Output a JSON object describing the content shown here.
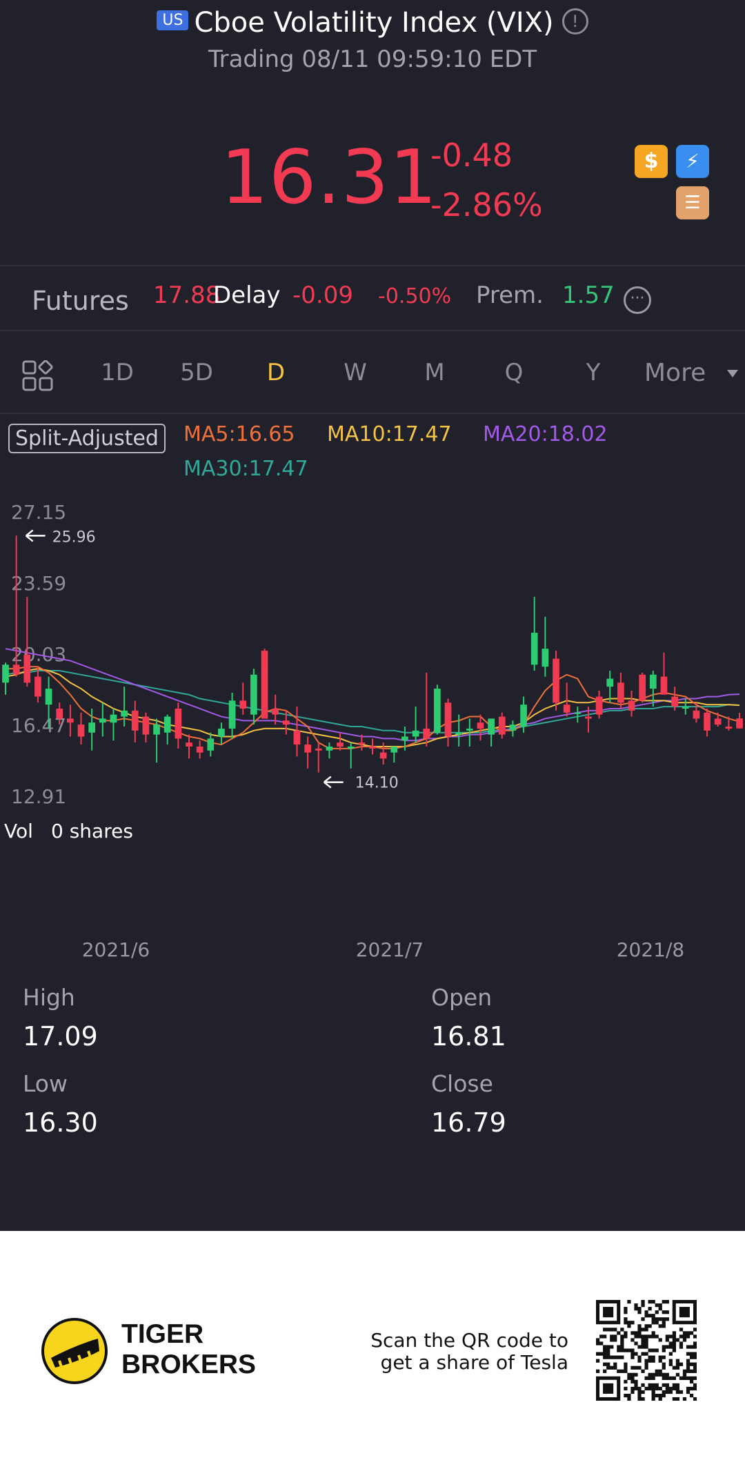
{
  "header": {
    "market_badge": "US",
    "title": "Cboe Volatility Index (VIX)",
    "info_icon": "!",
    "status": "Trading 08/11 09:59:10 EDT"
  },
  "quote": {
    "price": "16.31",
    "change": "-0.48",
    "change_pct": "-2.86%",
    "down_color": "#f23b52",
    "icons": [
      "dollar-icon",
      "lightning-icon",
      "stack-icon"
    ]
  },
  "futures": {
    "label": "Futures",
    "price": "17.88",
    "delay": "Delay",
    "change": "-0.09",
    "change_pct": "-0.50%",
    "prem_label": "Prem.",
    "prem_value": "1.57"
  },
  "tabs": {
    "items": [
      "1D",
      "5D",
      "D",
      "W",
      "M",
      "Q",
      "Y"
    ],
    "active": "D",
    "more": "More"
  },
  "chart_legend": {
    "adjust": "Split-Adjusted",
    "ma5": "MA5:16.65",
    "ma10": "MA10:17.47",
    "ma20": "MA20:18.02",
    "ma30": "MA30:17.47",
    "ma5_color": "#f0703a",
    "ma10_color": "#f6c244",
    "ma20_color": "#a35ae8",
    "ma30_color": "#31a89a"
  },
  "chart_data": {
    "type": "candlestick",
    "y_ticks": [
      "27.15",
      "23.59",
      "20.03",
      "16.47",
      "12.91"
    ],
    "ylim": [
      12.91,
      27.15
    ],
    "x_labels": [
      "2021/6",
      "2021/7",
      "2021/8"
    ],
    "max_marker": "25.96",
    "min_marker": "14.10",
    "up_color": "#2ecc71",
    "down_color": "#f23b52",
    "candles": [
      {
        "o": 18.6,
        "h": 19.6,
        "l": 18.0,
        "c": 19.5
      },
      {
        "o": 19.5,
        "h": 25.96,
        "l": 18.9,
        "c": 19.0
      },
      {
        "o": 20.0,
        "h": 22.9,
        "l": 18.4,
        "c": 18.6
      },
      {
        "o": 18.9,
        "h": 19.4,
        "l": 17.6,
        "c": 17.9
      },
      {
        "o": 17.5,
        "h": 18.9,
        "l": 16.3,
        "c": 18.3
      },
      {
        "o": 17.3,
        "h": 17.6,
        "l": 16.5,
        "c": 16.8
      },
      {
        "o": 16.8,
        "h": 17.5,
        "l": 15.9,
        "c": 16.6
      },
      {
        "o": 16.5,
        "h": 17.1,
        "l": 15.5,
        "c": 15.9
      },
      {
        "o": 16.1,
        "h": 17.3,
        "l": 15.2,
        "c": 16.6
      },
      {
        "o": 16.6,
        "h": 17.6,
        "l": 15.9,
        "c": 16.8
      },
      {
        "o": 16.6,
        "h": 17.3,
        "l": 15.7,
        "c": 17.0
      },
      {
        "o": 16.9,
        "h": 18.4,
        "l": 16.4,
        "c": 17.2
      },
      {
        "o": 17.2,
        "h": 17.7,
        "l": 15.6,
        "c": 16.2
      },
      {
        "o": 16.9,
        "h": 17.1,
        "l": 15.6,
        "c": 16.0
      },
      {
        "o": 16.0,
        "h": 16.8,
        "l": 14.6,
        "c": 16.5
      },
      {
        "o": 16.1,
        "h": 17.0,
        "l": 15.5,
        "c": 16.9
      },
      {
        "o": 17.3,
        "h": 17.6,
        "l": 15.3,
        "c": 15.8
      },
      {
        "o": 15.6,
        "h": 16.0,
        "l": 14.8,
        "c": 15.4
      },
      {
        "o": 15.4,
        "h": 15.7,
        "l": 14.8,
        "c": 15.1
      },
      {
        "o": 15.2,
        "h": 16.1,
        "l": 14.9,
        "c": 15.8
      },
      {
        "o": 15.9,
        "h": 16.6,
        "l": 15.5,
        "c": 16.3
      },
      {
        "o": 16.3,
        "h": 18.1,
        "l": 15.8,
        "c": 17.7
      },
      {
        "o": 17.7,
        "h": 18.6,
        "l": 17.0,
        "c": 17.3
      },
      {
        "o": 17.0,
        "h": 19.3,
        "l": 16.5,
        "c": 19.0
      },
      {
        "o": 20.2,
        "h": 20.3,
        "l": 16.8,
        "c": 16.8
      },
      {
        "o": 17.3,
        "h": 18.0,
        "l": 16.5,
        "c": 17.0
      },
      {
        "o": 16.7,
        "h": 17.2,
        "l": 16.0,
        "c": 16.5
      },
      {
        "o": 16.2,
        "h": 17.4,
        "l": 14.9,
        "c": 15.5
      },
      {
        "o": 15.5,
        "h": 15.9,
        "l": 14.3,
        "c": 15.1
      },
      {
        "o": 15.3,
        "h": 15.6,
        "l": 14.1,
        "c": 15.2
      },
      {
        "o": 15.2,
        "h": 15.6,
        "l": 14.8,
        "c": 15.4
      },
      {
        "o": 15.6,
        "h": 16.1,
        "l": 15.2,
        "c": 15.4
      },
      {
        "o": 15.3,
        "h": 15.6,
        "l": 14.3,
        "c": 15.4
      },
      {
        "o": 15.6,
        "h": 16.0,
        "l": 15.2,
        "c": 15.5
      },
      {
        "o": 15.4,
        "h": 15.8,
        "l": 15.0,
        "c": 15.3
      },
      {
        "o": 15.1,
        "h": 15.6,
        "l": 14.5,
        "c": 14.8
      },
      {
        "o": 15.1,
        "h": 15.3,
        "l": 14.6,
        "c": 15.4
      },
      {
        "o": 15.7,
        "h": 16.4,
        "l": 15.2,
        "c": 15.9
      },
      {
        "o": 15.9,
        "h": 17.4,
        "l": 15.6,
        "c": 16.2
      },
      {
        "o": 16.3,
        "h": 19.1,
        "l": 15.4,
        "c": 15.8
      },
      {
        "o": 16.1,
        "h": 18.5,
        "l": 16.0,
        "c": 18.3
      },
      {
        "o": 17.6,
        "h": 17.8,
        "l": 15.4,
        "c": 15.9
      },
      {
        "o": 16.0,
        "h": 17.0,
        "l": 15.4,
        "c": 16.1
      },
      {
        "o": 16.2,
        "h": 16.8,
        "l": 15.4,
        "c": 16.3
      },
      {
        "o": 16.6,
        "h": 17.0,
        "l": 15.7,
        "c": 16.3
      },
      {
        "o": 16.0,
        "h": 16.8,
        "l": 15.4,
        "c": 16.8
      },
      {
        "o": 16.9,
        "h": 17.1,
        "l": 15.8,
        "c": 16.0
      },
      {
        "o": 16.2,
        "h": 16.7,
        "l": 15.9,
        "c": 16.5
      },
      {
        "o": 16.4,
        "h": 17.9,
        "l": 16.1,
        "c": 17.5
      },
      {
        "o": 19.5,
        "h": 22.9,
        "l": 19.2,
        "c": 21.1
      },
      {
        "o": 19.4,
        "h": 21.9,
        "l": 18.9,
        "c": 20.3
      },
      {
        "o": 19.8,
        "h": 20.2,
        "l": 17.2,
        "c": 17.6
      },
      {
        "o": 17.5,
        "h": 18.6,
        "l": 16.9,
        "c": 17.1
      },
      {
        "o": 17.1,
        "h": 17.4,
        "l": 16.6,
        "c": 17.1
      },
      {
        "o": 16.9,
        "h": 17.4,
        "l": 16.1,
        "c": 16.8
      },
      {
        "o": 17.9,
        "h": 18.2,
        "l": 16.8,
        "c": 17.0
      },
      {
        "o": 18.4,
        "h": 19.2,
        "l": 17.6,
        "c": 18.8
      },
      {
        "o": 18.6,
        "h": 19.1,
        "l": 17.3,
        "c": 17.6
      },
      {
        "o": 17.7,
        "h": 18.2,
        "l": 16.9,
        "c": 17.2
      },
      {
        "o": 19.0,
        "h": 19.1,
        "l": 17.6,
        "c": 17.7
      },
      {
        "o": 18.3,
        "h": 19.2,
        "l": 17.4,
        "c": 19.0
      },
      {
        "o": 18.9,
        "h": 20.1,
        "l": 18.0,
        "c": 18.0
      },
      {
        "o": 17.9,
        "h": 18.4,
        "l": 17.2,
        "c": 17.4
      },
      {
        "o": 17.3,
        "h": 17.8,
        "l": 17.0,
        "c": 17.4
      },
      {
        "o": 17.2,
        "h": 17.6,
        "l": 16.6,
        "c": 16.8
      },
      {
        "o": 17.1,
        "h": 17.3,
        "l": 15.9,
        "c": 16.2
      },
      {
        "o": 16.8,
        "h": 17.1,
        "l": 16.4,
        "c": 16.5
      },
      {
        "o": 16.4,
        "h": 16.9,
        "l": 16.2,
        "c": 16.3
      },
      {
        "o": 16.81,
        "h": 17.09,
        "l": 16.3,
        "c": 16.31
      }
    ],
    "ma_lines": {
      "ma5": [
        19.3,
        19.3,
        19.4,
        19.4,
        19.1,
        18.6,
        18.0,
        17.3,
        16.9,
        16.7,
        16.7,
        16.8,
        16.7,
        16.6,
        16.5,
        16.3,
        16.1,
        15.9,
        15.8,
        15.6,
        15.5,
        15.8,
        16.1,
        16.6,
        17.1,
        17.3,
        17.2,
        16.8,
        16.4,
        15.6,
        15.3,
        15.3,
        15.3,
        15.4,
        15.4,
        15.3,
        15.3,
        15.4,
        15.6,
        15.8,
        16.3,
        16.6,
        16.7,
        16.9,
        16.9,
        16.4,
        16.2,
        16.2,
        16.5,
        17.4,
        18.2,
        18.7,
        19.0,
        18.8,
        17.9,
        17.7,
        17.6,
        17.5,
        17.6,
        17.8,
        18.0,
        18.1,
        18.0,
        17.9,
        17.5,
        17.2,
        17.0,
        16.8,
        16.65
      ],
      "ma10": [
        18.9,
        19.0,
        19.2,
        19.3,
        19.2,
        19.0,
        18.6,
        18.3,
        17.9,
        17.6,
        17.3,
        17.1,
        16.9,
        16.8,
        16.7,
        16.5,
        16.4,
        16.3,
        16.2,
        16.0,
        15.9,
        15.9,
        16.0,
        16.2,
        16.3,
        16.3,
        16.3,
        16.2,
        16.1,
        16.0,
        15.9,
        15.8,
        15.6,
        15.5,
        15.4,
        15.4,
        15.4,
        15.4,
        15.5,
        15.6,
        15.8,
        15.9,
        16.0,
        16.1,
        16.2,
        16.3,
        16.4,
        16.4,
        16.6,
        17.0,
        17.3,
        17.5,
        17.7,
        17.6,
        17.6,
        17.7,
        17.8,
        17.8,
        17.8,
        17.7,
        17.7,
        17.7,
        17.6,
        17.6,
        17.6,
        17.5,
        17.5,
        17.5,
        17.47
      ],
      "ma20": [
        20.3,
        20.2,
        20.1,
        20.0,
        19.9,
        19.8,
        19.7,
        19.5,
        19.3,
        19.1,
        18.9,
        18.7,
        18.5,
        18.3,
        18.1,
        17.9,
        17.7,
        17.5,
        17.3,
        17.1,
        16.9,
        16.8,
        16.7,
        16.7,
        16.7,
        16.7,
        16.6,
        16.5,
        16.4,
        16.3,
        16.2,
        16.1,
        16.0,
        15.9,
        15.9,
        15.8,
        15.8,
        15.7,
        15.7,
        15.8,
        15.8,
        15.9,
        15.9,
        16.0,
        16.0,
        16.1,
        16.2,
        16.3,
        16.5,
        16.6,
        16.8,
        16.9,
        17.0,
        17.1,
        17.2,
        17.2,
        17.3,
        17.3,
        17.4,
        17.5,
        17.6,
        17.7,
        17.7,
        17.8,
        17.8,
        17.9,
        17.9,
        18.0,
        18.02
      ],
      "ma30": [
        19.0,
        19.1,
        19.1,
        19.2,
        19.2,
        19.2,
        19.1,
        19.0,
        18.9,
        18.8,
        18.7,
        18.6,
        18.5,
        18.4,
        18.3,
        18.2,
        18.1,
        18.0,
        17.8,
        17.7,
        17.6,
        17.5,
        17.4,
        17.3,
        17.2,
        17.1,
        17.0,
        16.9,
        16.8,
        16.7,
        16.6,
        16.5,
        16.4,
        16.4,
        16.3,
        16.2,
        16.2,
        16.1,
        16.1,
        16.1,
        16.1,
        16.1,
        16.1,
        16.1,
        16.1,
        16.2,
        16.2,
        16.3,
        16.4,
        16.5,
        16.6,
        16.7,
        16.8,
        16.9,
        17.0,
        17.1,
        17.2,
        17.2,
        17.3,
        17.3,
        17.3,
        17.4,
        17.4,
        17.4,
        17.4,
        17.4,
        17.4,
        17.5,
        17.47
      ]
    }
  },
  "volume": {
    "label": "Vol",
    "value": "0 shares"
  },
  "stats": {
    "high_label": "High",
    "high": "17.09",
    "open_label": "Open",
    "open": "16.81",
    "low_label": "Low",
    "low": "16.30",
    "close_label": "Close",
    "close": "16.79"
  },
  "footer": {
    "brand_line1": "TIGER",
    "brand_line2": "BROKERS",
    "promo_line1": "Scan the QR code to",
    "promo_line2": "get a share of Tesla"
  }
}
